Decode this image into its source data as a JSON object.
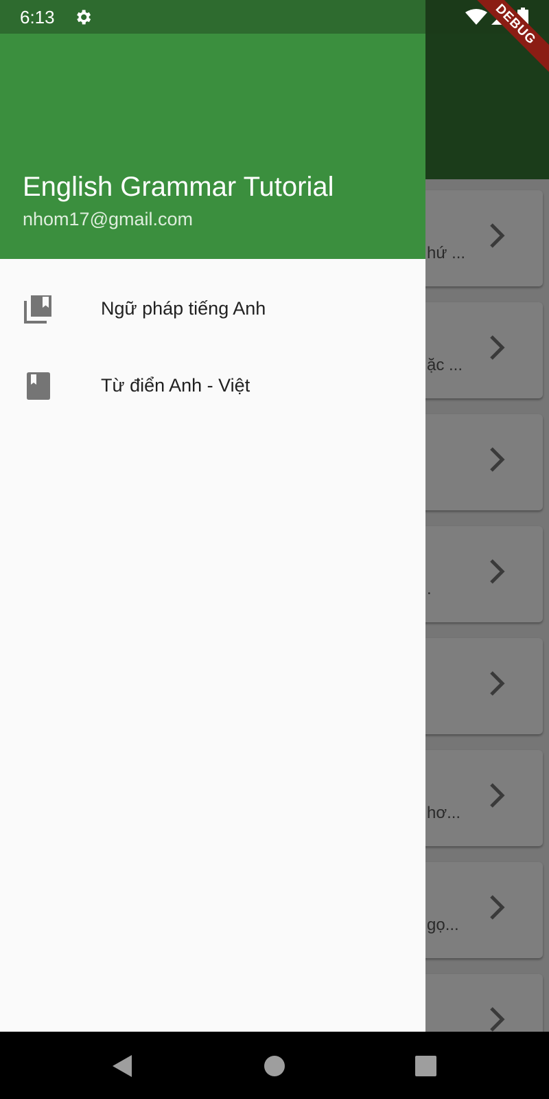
{
  "status_bar": {
    "time": "6:13"
  },
  "debug_banner": "DEBUG",
  "drawer": {
    "header": {
      "title": "English Grammar Tutorial",
      "email": "nhom17@gmail.com"
    },
    "items": [
      {
        "label": "Ngữ pháp tiếng Anh",
        "icon": "library-books-icon"
      },
      {
        "label": "Từ điển Anh - Việt",
        "icon": "book-icon"
      }
    ]
  },
  "background_list": {
    "snippets": [
      "hứ ...",
      "ặc ...",
      "",
      ".",
      "",
      "hơ...",
      "gọ...",
      ""
    ]
  },
  "colors": {
    "drawer_header": "#3b8f3e",
    "status_bar_drawer": "#2e6b2f",
    "app_bar_dimmed": "#1b3c1a",
    "debug_ribbon": "#8b1d14"
  }
}
